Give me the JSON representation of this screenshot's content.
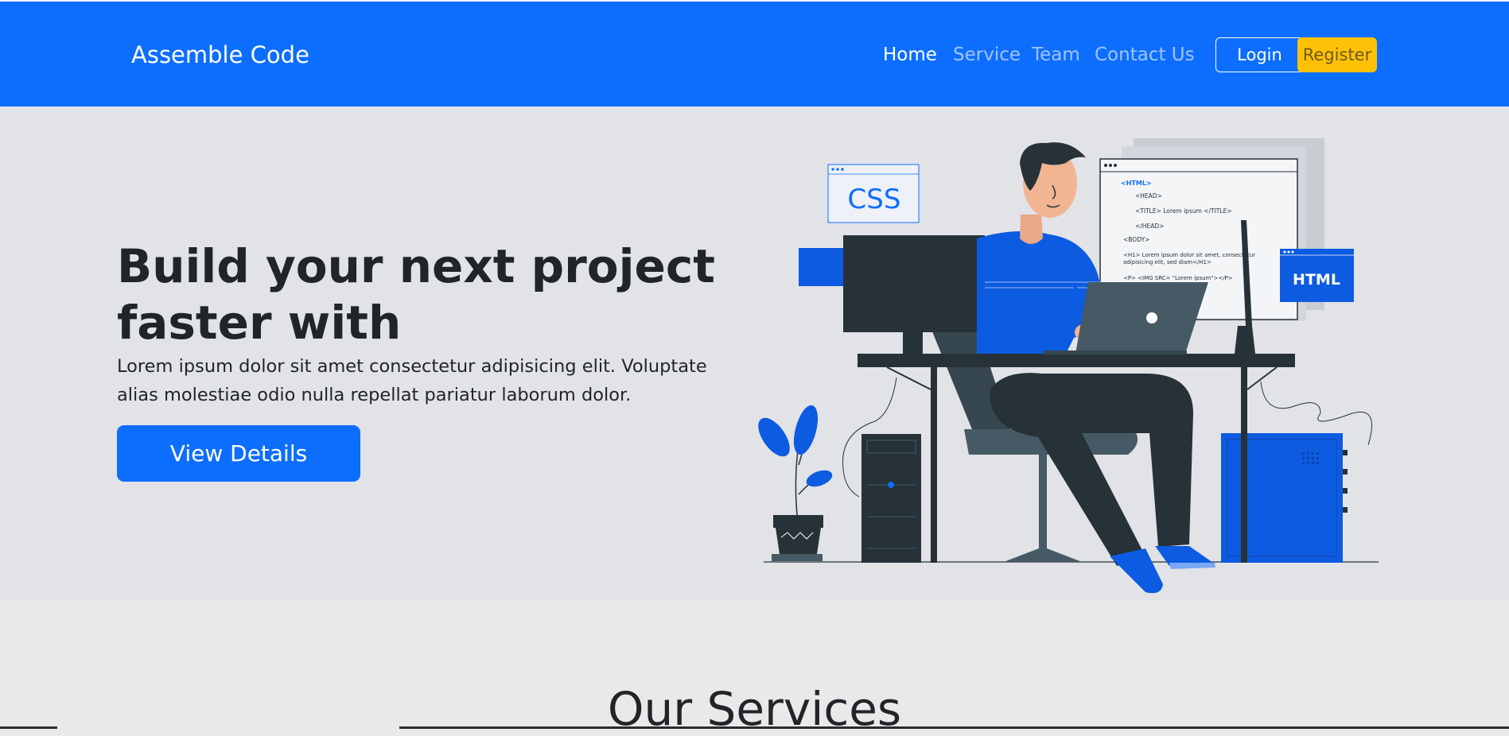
{
  "navbar": {
    "brand": "Assemble Code",
    "links": [
      "Home",
      "Service",
      "Team",
      "Contact Us"
    ],
    "login_label": "Login",
    "register_label": "Register"
  },
  "hero": {
    "title": "Build your next project faster with",
    "text": "Lorem ipsum dolor sit amet consectetur adipisicing elit. Voluptate alias molestiae odio nulla repellat pariatur laborum dolor.",
    "button_label": "View Details"
  },
  "illustration": {
    "css_label": "CSS",
    "html_label": "HTML",
    "code_lines": [
      "<HTML>",
      "<HEAD>",
      "<TITLE> Lorem ipsum </TITLE>",
      "</HEAD>",
      "<BODY>",
      "<H1> Lorem ipsum dolor sit amet, consectetur",
      "adipisicing elit, sed diam</H1>",
      "<P> <IMG SRC= \"Lorem ipsum\"></P>"
    ]
  },
  "services": {
    "title": "Our Services"
  },
  "colors": {
    "primary": "#0d6efd",
    "warning": "#ffc107",
    "hero_bg": "#e2e3e7",
    "page_bg": "#e9e9ea",
    "dark": "#263238"
  }
}
